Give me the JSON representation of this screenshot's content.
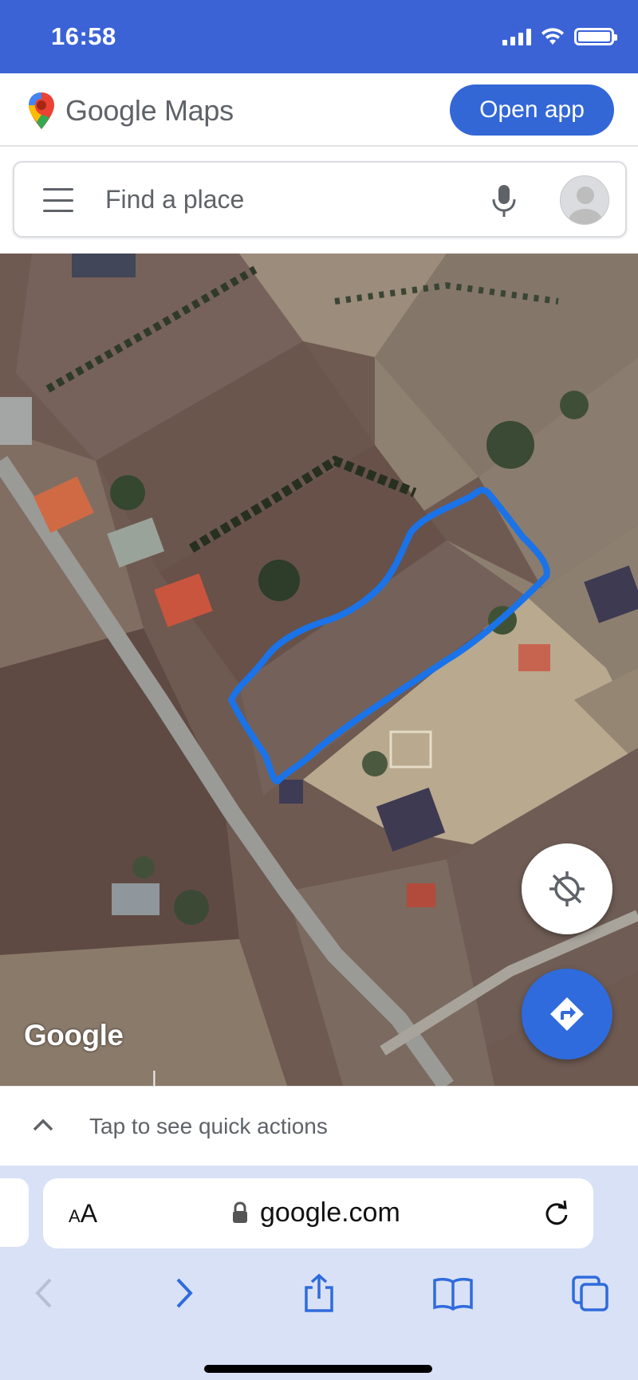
{
  "status_bar": {
    "time": "16:58",
    "icons": [
      "signal-icon",
      "wifi-icon",
      "battery-icon"
    ]
  },
  "header": {
    "logo_icon": "google-maps-pin-icon",
    "brand_name": "Google Maps",
    "open_app_label": "Open app",
    "colors": {
      "status_bar": "#3b63d6",
      "button": "#3367d6",
      "route_line": "#1a73e8"
    }
  },
  "search": {
    "menu_icon": "hamburger-menu-icon",
    "placeholder": "Find a place",
    "mic_icon": "microphone-icon",
    "avatar_icon": "account-avatar-icon"
  },
  "map": {
    "view": "satellite",
    "watermark": "Google",
    "controls": {
      "location_icon": "location-off-icon",
      "directions_icon": "directions-icon"
    },
    "drawn_overlay": "blue outlined land plot"
  },
  "quick_actions": {
    "icon": "chevron-up-icon",
    "label": "Tap to see quick actions"
  },
  "browser": {
    "text_size_label_big": "A",
    "text_size_label_small": "A",
    "lock_icon": "lock-icon",
    "address": "google.com",
    "reload_icon": "reload-icon",
    "toolbar_icons": [
      "back-icon",
      "forward-icon",
      "share-icon",
      "bookmarks-icon",
      "tabs-icon"
    ]
  }
}
